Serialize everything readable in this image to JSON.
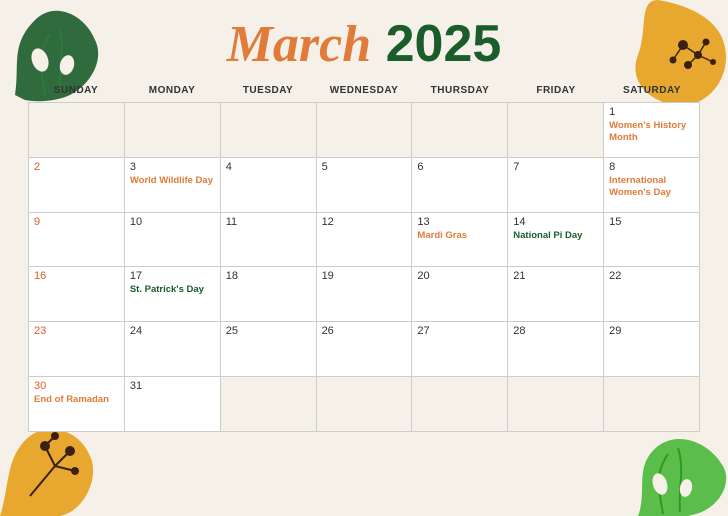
{
  "header": {
    "month": "March",
    "year": "2025"
  },
  "day_headers": [
    "SUNDAY",
    "MONDAY",
    "TUESDAY",
    "WEDNESDAY",
    "THURSDAY",
    "FRIDAY",
    "SATURDAY"
  ],
  "weeks": [
    [
      {
        "date": null,
        "event": null,
        "is_sunday": false
      },
      {
        "date": null,
        "event": null,
        "is_sunday": false
      },
      {
        "date": null,
        "event": null,
        "is_sunday": false
      },
      {
        "date": null,
        "event": null,
        "is_sunday": false
      },
      {
        "date": null,
        "event": null,
        "is_sunday": false
      },
      {
        "date": null,
        "event": null,
        "is_sunday": false
      },
      {
        "date": "1",
        "event": "Women's History Month",
        "event_color": "orange",
        "is_sunday": false
      }
    ],
    [
      {
        "date": "2",
        "event": null,
        "is_sunday": true
      },
      {
        "date": "3",
        "event": "World Wildlife Day",
        "event_color": "orange",
        "is_sunday": false
      },
      {
        "date": "4",
        "event": null,
        "is_sunday": false
      },
      {
        "date": "5",
        "event": null,
        "is_sunday": false
      },
      {
        "date": "6",
        "event": null,
        "is_sunday": false
      },
      {
        "date": "7",
        "event": null,
        "is_sunday": false
      },
      {
        "date": "8",
        "event": "International Women's Day",
        "event_color": "orange",
        "is_sunday": false
      }
    ],
    [
      {
        "date": "9",
        "event": null,
        "is_sunday": true
      },
      {
        "date": "10",
        "event": null,
        "is_sunday": false
      },
      {
        "date": "11",
        "event": null,
        "is_sunday": false
      },
      {
        "date": "12",
        "event": null,
        "is_sunday": false
      },
      {
        "date": "13",
        "event": "Mardi Gras",
        "event_color": "orange",
        "is_sunday": false
      },
      {
        "date": "14",
        "event": "National Pi Day",
        "event_color": "green",
        "is_sunday": false
      },
      {
        "date": "15",
        "event": null,
        "is_sunday": false
      }
    ],
    [
      {
        "date": "16",
        "event": null,
        "is_sunday": true
      },
      {
        "date": "17",
        "event": "St. Patrick's Day",
        "event_color": "green",
        "is_sunday": false
      },
      {
        "date": "18",
        "event": null,
        "is_sunday": false
      },
      {
        "date": "19",
        "event": null,
        "is_sunday": false
      },
      {
        "date": "20",
        "event": null,
        "is_sunday": false
      },
      {
        "date": "21",
        "event": null,
        "is_sunday": false
      },
      {
        "date": "22",
        "event": null,
        "is_sunday": false
      }
    ],
    [
      {
        "date": "23",
        "event": null,
        "is_sunday": true
      },
      {
        "date": "24",
        "event": null,
        "is_sunday": false
      },
      {
        "date": "25",
        "event": null,
        "is_sunday": false
      },
      {
        "date": "26",
        "event": null,
        "is_sunday": false
      },
      {
        "date": "27",
        "event": null,
        "is_sunday": false
      },
      {
        "date": "28",
        "event": null,
        "is_sunday": false
      },
      {
        "date": "29",
        "event": null,
        "is_sunday": false
      }
    ],
    [
      {
        "date": "30",
        "event": "End of Ramadan",
        "event_color": "orange",
        "is_sunday": true
      },
      {
        "date": "31",
        "event": null,
        "is_sunday": false
      },
      {
        "date": null,
        "event": null,
        "is_sunday": false
      },
      {
        "date": null,
        "event": null,
        "is_sunday": false
      },
      {
        "date": null,
        "event": null,
        "is_sunday": false
      },
      {
        "date": null,
        "event": null,
        "is_sunday": false
      },
      {
        "date": null,
        "event": null,
        "is_sunday": false
      }
    ]
  ]
}
